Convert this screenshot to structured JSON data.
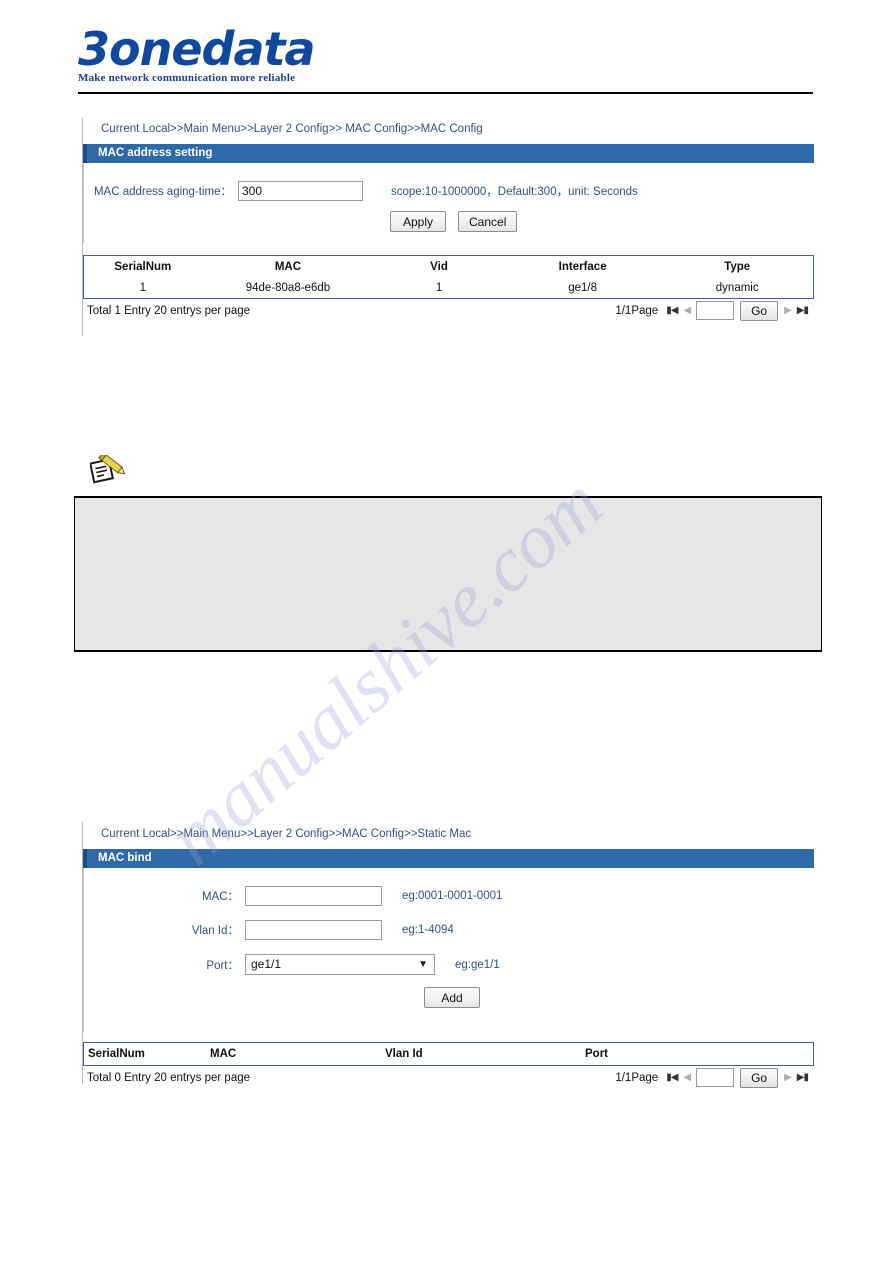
{
  "brand": {
    "logo_text": "3onedata",
    "tagline": "Make network communication more reliable"
  },
  "section1": {
    "breadcrumb": "Current Local>>Main Menu>>Layer 2 Config>> MAC Config>>MAC Config",
    "panel_title": "MAC address setting",
    "form": {
      "aging_label": "MAC address aging-time：",
      "aging_value": "300",
      "aging_hint": "scope:10-1000000，Default:300，unit: Seconds",
      "apply_label": "Apply",
      "cancel_label": "Cancel"
    },
    "table": {
      "columns": [
        "SerialNum",
        "MAC",
        "Vid",
        "Interface",
        "Type"
      ],
      "rows": [
        [
          "1",
          "94de-80a8-e6db",
          "1",
          "ge1/8",
          "dynamic"
        ]
      ]
    },
    "footer": {
      "total_text": "Total 1 Entry  20 entrys per page",
      "page_text": "1/1Page",
      "page_input_value": "",
      "go_label": "Go",
      "first_icon": "first-page-icon",
      "prev_icon": "prev-page-icon",
      "next_icon": "next-page-icon",
      "last_icon": "last-page-icon"
    }
  },
  "note": {
    "icon_name": "note-pencil-icon",
    "body_text": ""
  },
  "section2": {
    "breadcrumb": "Current Local>>Main Menu>>Layer 2 Config>>MAC Config>>Static Mac",
    "panel_title": "MAC bind",
    "form": {
      "mac_label": "MAC：",
      "mac_value": "",
      "mac_hint": "eg:0001-0001-0001",
      "vlan_label": "Vlan Id：",
      "vlan_value": "",
      "vlan_hint": "eg:1-4094",
      "port_label": "Port：",
      "port_value": "ge1/1",
      "port_hint": "eg:ge1/1",
      "add_label": "Add"
    },
    "table": {
      "columns": [
        "SerialNum",
        "MAC",
        "Vlan Id",
        "Port"
      ],
      "rows": []
    },
    "footer": {
      "total_text": "Total 0 Entry  20 entrys per page",
      "page_text": "1/1Page",
      "page_input_value": "",
      "go_label": "Go",
      "first_icon": "first-page-icon",
      "prev_icon": "prev-page-icon",
      "next_icon": "next-page-icon",
      "last_icon": "last-page-icon"
    }
  },
  "watermark": {
    "text": "manualshive.com"
  },
  "colors": {
    "bar_blue": "#2e69a8",
    "bar_blue_dark": "#1b4a80",
    "link_blue": "#3b4a8c",
    "table_border": "#3c5f96",
    "logo_blue": "#10489e"
  }
}
